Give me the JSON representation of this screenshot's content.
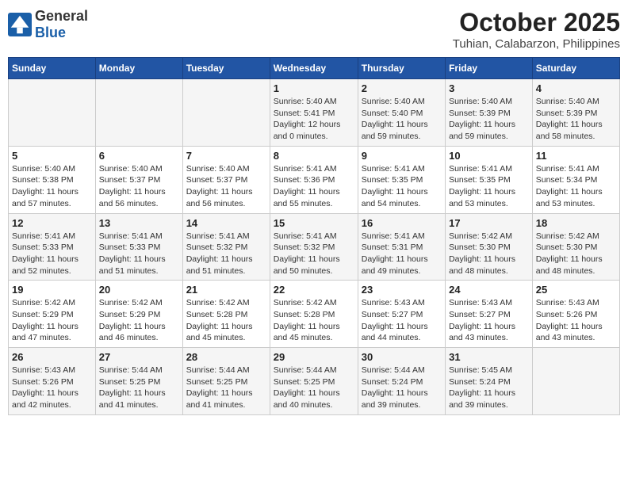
{
  "logo": {
    "general": "General",
    "blue": "Blue"
  },
  "title": "October 2025",
  "subtitle": "Tuhian, Calabarzon, Philippines",
  "days_of_week": [
    "Sunday",
    "Monday",
    "Tuesday",
    "Wednesday",
    "Thursday",
    "Friday",
    "Saturday"
  ],
  "weeks": [
    [
      {
        "day": "",
        "sunrise": "",
        "sunset": "",
        "daylight": ""
      },
      {
        "day": "",
        "sunrise": "",
        "sunset": "",
        "daylight": ""
      },
      {
        "day": "",
        "sunrise": "",
        "sunset": "",
        "daylight": ""
      },
      {
        "day": "1",
        "sunrise": "Sunrise: 5:40 AM",
        "sunset": "Sunset: 5:41 PM",
        "daylight": "Daylight: 12 hours and 0 minutes."
      },
      {
        "day": "2",
        "sunrise": "Sunrise: 5:40 AM",
        "sunset": "Sunset: 5:40 PM",
        "daylight": "Daylight: 11 hours and 59 minutes."
      },
      {
        "day": "3",
        "sunrise": "Sunrise: 5:40 AM",
        "sunset": "Sunset: 5:39 PM",
        "daylight": "Daylight: 11 hours and 59 minutes."
      },
      {
        "day": "4",
        "sunrise": "Sunrise: 5:40 AM",
        "sunset": "Sunset: 5:39 PM",
        "daylight": "Daylight: 11 hours and 58 minutes."
      }
    ],
    [
      {
        "day": "5",
        "sunrise": "Sunrise: 5:40 AM",
        "sunset": "Sunset: 5:38 PM",
        "daylight": "Daylight: 11 hours and 57 minutes."
      },
      {
        "day": "6",
        "sunrise": "Sunrise: 5:40 AM",
        "sunset": "Sunset: 5:37 PM",
        "daylight": "Daylight: 11 hours and 56 minutes."
      },
      {
        "day": "7",
        "sunrise": "Sunrise: 5:40 AM",
        "sunset": "Sunset: 5:37 PM",
        "daylight": "Daylight: 11 hours and 56 minutes."
      },
      {
        "day": "8",
        "sunrise": "Sunrise: 5:41 AM",
        "sunset": "Sunset: 5:36 PM",
        "daylight": "Daylight: 11 hours and 55 minutes."
      },
      {
        "day": "9",
        "sunrise": "Sunrise: 5:41 AM",
        "sunset": "Sunset: 5:35 PM",
        "daylight": "Daylight: 11 hours and 54 minutes."
      },
      {
        "day": "10",
        "sunrise": "Sunrise: 5:41 AM",
        "sunset": "Sunset: 5:35 PM",
        "daylight": "Daylight: 11 hours and 53 minutes."
      },
      {
        "day": "11",
        "sunrise": "Sunrise: 5:41 AM",
        "sunset": "Sunset: 5:34 PM",
        "daylight": "Daylight: 11 hours and 53 minutes."
      }
    ],
    [
      {
        "day": "12",
        "sunrise": "Sunrise: 5:41 AM",
        "sunset": "Sunset: 5:33 PM",
        "daylight": "Daylight: 11 hours and 52 minutes."
      },
      {
        "day": "13",
        "sunrise": "Sunrise: 5:41 AM",
        "sunset": "Sunset: 5:33 PM",
        "daylight": "Daylight: 11 hours and 51 minutes."
      },
      {
        "day": "14",
        "sunrise": "Sunrise: 5:41 AM",
        "sunset": "Sunset: 5:32 PM",
        "daylight": "Daylight: 11 hours and 51 minutes."
      },
      {
        "day": "15",
        "sunrise": "Sunrise: 5:41 AM",
        "sunset": "Sunset: 5:32 PM",
        "daylight": "Daylight: 11 hours and 50 minutes."
      },
      {
        "day": "16",
        "sunrise": "Sunrise: 5:41 AM",
        "sunset": "Sunset: 5:31 PM",
        "daylight": "Daylight: 11 hours and 49 minutes."
      },
      {
        "day": "17",
        "sunrise": "Sunrise: 5:42 AM",
        "sunset": "Sunset: 5:30 PM",
        "daylight": "Daylight: 11 hours and 48 minutes."
      },
      {
        "day": "18",
        "sunrise": "Sunrise: 5:42 AM",
        "sunset": "Sunset: 5:30 PM",
        "daylight": "Daylight: 11 hours and 48 minutes."
      }
    ],
    [
      {
        "day": "19",
        "sunrise": "Sunrise: 5:42 AM",
        "sunset": "Sunset: 5:29 PM",
        "daylight": "Daylight: 11 hours and 47 minutes."
      },
      {
        "day": "20",
        "sunrise": "Sunrise: 5:42 AM",
        "sunset": "Sunset: 5:29 PM",
        "daylight": "Daylight: 11 hours and 46 minutes."
      },
      {
        "day": "21",
        "sunrise": "Sunrise: 5:42 AM",
        "sunset": "Sunset: 5:28 PM",
        "daylight": "Daylight: 11 hours and 45 minutes."
      },
      {
        "day": "22",
        "sunrise": "Sunrise: 5:42 AM",
        "sunset": "Sunset: 5:28 PM",
        "daylight": "Daylight: 11 hours and 45 minutes."
      },
      {
        "day": "23",
        "sunrise": "Sunrise: 5:43 AM",
        "sunset": "Sunset: 5:27 PM",
        "daylight": "Daylight: 11 hours and 44 minutes."
      },
      {
        "day": "24",
        "sunrise": "Sunrise: 5:43 AM",
        "sunset": "Sunset: 5:27 PM",
        "daylight": "Daylight: 11 hours and 43 minutes."
      },
      {
        "day": "25",
        "sunrise": "Sunrise: 5:43 AM",
        "sunset": "Sunset: 5:26 PM",
        "daylight": "Daylight: 11 hours and 43 minutes."
      }
    ],
    [
      {
        "day": "26",
        "sunrise": "Sunrise: 5:43 AM",
        "sunset": "Sunset: 5:26 PM",
        "daylight": "Daylight: 11 hours and 42 minutes."
      },
      {
        "day": "27",
        "sunrise": "Sunrise: 5:44 AM",
        "sunset": "Sunset: 5:25 PM",
        "daylight": "Daylight: 11 hours and 41 minutes."
      },
      {
        "day": "28",
        "sunrise": "Sunrise: 5:44 AM",
        "sunset": "Sunset: 5:25 PM",
        "daylight": "Daylight: 11 hours and 41 minutes."
      },
      {
        "day": "29",
        "sunrise": "Sunrise: 5:44 AM",
        "sunset": "Sunset: 5:25 PM",
        "daylight": "Daylight: 11 hours and 40 minutes."
      },
      {
        "day": "30",
        "sunrise": "Sunrise: 5:44 AM",
        "sunset": "Sunset: 5:24 PM",
        "daylight": "Daylight: 11 hours and 39 minutes."
      },
      {
        "day": "31",
        "sunrise": "Sunrise: 5:45 AM",
        "sunset": "Sunset: 5:24 PM",
        "daylight": "Daylight: 11 hours and 39 minutes."
      },
      {
        "day": "",
        "sunrise": "",
        "sunset": "",
        "daylight": ""
      }
    ]
  ]
}
